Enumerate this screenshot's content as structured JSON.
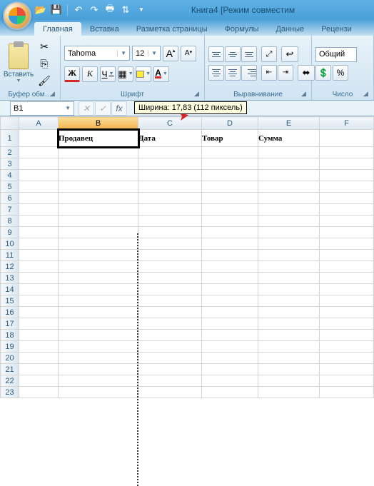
{
  "title": "Книга4  [Режим совместим",
  "qat": {
    "open_icon": "folder-open-icon",
    "save_icon": "save-icon",
    "undo_icon": "undo-icon",
    "redo_icon": "redo-icon",
    "print_icon": "print-icon",
    "sort_icon": "sort-icon"
  },
  "tabs": [
    "Главная",
    "Вставка",
    "Разметка страницы",
    "Формулы",
    "Данные",
    "Рецензи"
  ],
  "active_tab": 0,
  "clipboard": {
    "paste_label": "Вставить",
    "group_label": "Буфер обм…"
  },
  "font": {
    "group_label": "Шрифт",
    "name": "Tahoma",
    "size": "12",
    "bold": "Ж",
    "italic": "К",
    "underline": "Ч",
    "inc": "A",
    "dec": "A"
  },
  "alignment": {
    "group_label": "Выравнивание"
  },
  "number": {
    "group_label": "Число",
    "format": "Общий"
  },
  "name_box": "B1",
  "fx_label": "fx",
  "tooltip": "Ширина: 17,83 (112 пиксель)",
  "columns": [
    "A",
    "B",
    "C",
    "D",
    "E",
    "F"
  ],
  "selected_column": "B",
  "headers": {
    "B": "Продавец",
    "C": "Дата",
    "D": "Товар",
    "E": "Сумма"
  },
  "row_count": 23
}
